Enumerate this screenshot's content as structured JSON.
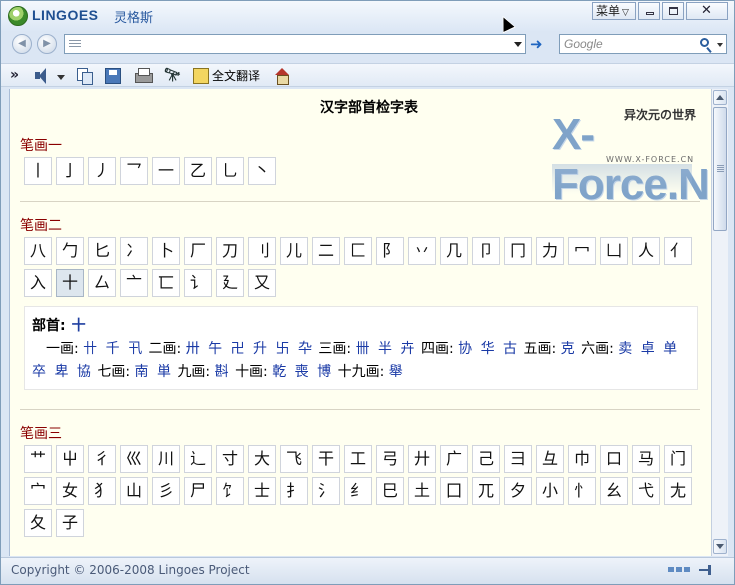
{
  "window": {
    "brand": "LINGOES",
    "brand_cn": "灵格斯",
    "menu_label": "菜单",
    "close_label": "✕"
  },
  "nav": {
    "address_value": "",
    "search_placeholder": "Google"
  },
  "toolbar": {
    "translate_label": "全文翻译"
  },
  "page": {
    "title": "汉字部首检字表",
    "logo": {
      "cn": "异次元の世界",
      "main": "X-Force.N",
      "sub": "WWW.X-FORCE.CN"
    }
  },
  "sections": [
    {
      "title": "笔画一",
      "chars": [
        "丨",
        "亅",
        "丿",
        "乛",
        "一",
        "乙",
        "乚",
        "丶"
      ]
    },
    {
      "title": "笔画二",
      "chars": [
        "八",
        "勹",
        "匕",
        "冫",
        "卜",
        "厂",
        "刀",
        "刂",
        "儿",
        "二",
        "匚",
        "阝",
        "丷",
        "几",
        "卩",
        "冂",
        "力",
        "冖",
        "凵",
        "人",
        "亻",
        "入",
        "十",
        "厶",
        "亠",
        "匸",
        "讠",
        "廴",
        "又"
      ],
      "selected_index": 22
    },
    {
      "title": "笔画三",
      "chars": [
        "艹",
        "屮",
        "彳",
        "巛",
        "川",
        "辶",
        "寸",
        "大",
        "飞",
        "干",
        "工",
        "弓",
        "廾",
        "广",
        "己",
        "彐",
        "彑",
        "巾",
        "口",
        "马",
        "门",
        "宀",
        "女",
        "犭",
        "山",
        "彡",
        "尸",
        "饣",
        "士",
        "扌",
        "氵",
        "纟",
        "巳",
        "土",
        "囗",
        "兀",
        "夕",
        "小",
        "忄",
        "幺",
        "弋",
        "尢",
        "夂",
        "子"
      ]
    }
  ],
  "detail": {
    "radical_label": "部首:",
    "radical": "十",
    "groups": [
      {
        "label": "一画:",
        "chars": "卄 千 卂"
      },
      {
        "label": "二画:",
        "chars": "卅 午 卍 升 卐 卆"
      },
      {
        "label": "三画:",
        "chars": "卌 半 卉"
      },
      {
        "label": "四画:",
        "chars": "协 华 古"
      },
      {
        "label": "五画:",
        "chars": "克"
      },
      {
        "label": "六画:",
        "chars": "卖 卓 单 卒 卑 協"
      },
      {
        "label": "七画:",
        "chars": "南 単"
      },
      {
        "label": "九画:",
        "chars": "斟"
      },
      {
        "label": "十画:",
        "chars": "乾 喪 博"
      },
      {
        "label": "十九画:",
        "chars": "舉"
      }
    ]
  },
  "status": {
    "copyright": "Copyright © 2006-2008 Lingoes Project"
  }
}
